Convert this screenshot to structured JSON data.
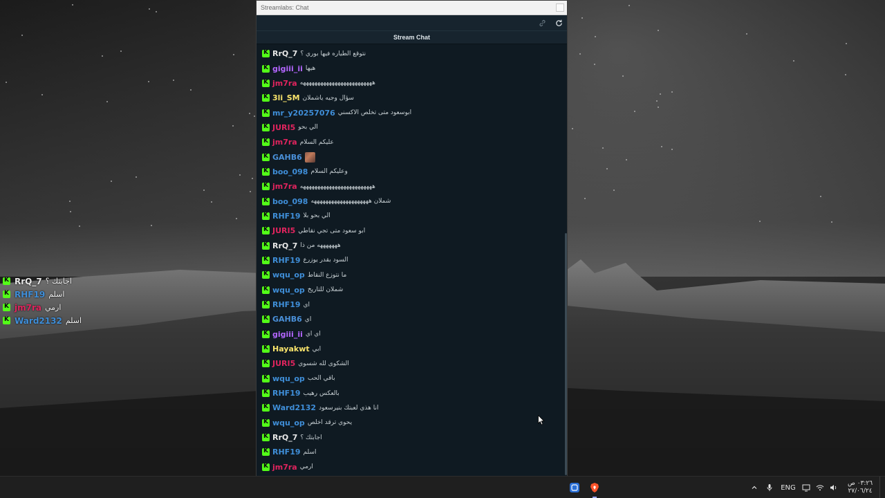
{
  "window": {
    "title": "Streamlabs: Chat",
    "header_title": "Stream Chat",
    "icons": {
      "link": "link-icon",
      "refresh": "refresh-icon",
      "close": "close-icon"
    }
  },
  "colors": {
    "platform_badge": "#53fc18",
    "chat_background": "#0f1a22",
    "header_background": "#17242e"
  },
  "messages": [
    {
      "user": "RrQ_7",
      "color": "#e6e6e6",
      "text": "نتوقع الطياره فيها بوري ؟"
    },
    {
      "user": "gigiii_ii",
      "color": "#b366ff",
      "text": "هيها"
    },
    {
      "user": "jm7ra",
      "color": "#e0245e",
      "text": "هههههههههههههههههههههههههه"
    },
    {
      "user": "3li_SM",
      "color": "#f8e36b",
      "text": "سؤال وجيه ياشملان"
    },
    {
      "user": "mr_y20257076",
      "color": "#3f8ed8",
      "text": "ابوسعود متى تخلص الاكسني"
    },
    {
      "user": "JURI5",
      "color": "#e0245e",
      "text": "الي بحو"
    },
    {
      "user": "jm7ra",
      "color": "#e0245e",
      "text": "عليكم السلام"
    },
    {
      "user": "GAHB6",
      "color": "#4a90d9",
      "text": "",
      "emote": true
    },
    {
      "user": "boo_098",
      "color": "#3f8ed8",
      "text": "وعليكم السلام"
    },
    {
      "user": "jm7ra",
      "color": "#e0245e",
      "text": "هههههههههههههههههههههههههه"
    },
    {
      "user": "boo_098",
      "color": "#3f8ed8",
      "text": "شملان ههههههههههههههههههههه"
    },
    {
      "user": "RHF19",
      "color": "#3f8ed8",
      "text": "الي بحو بلا"
    },
    {
      "user": "JURI5",
      "color": "#e0245e",
      "text": "ابو سعود متى تجي نقاطي"
    },
    {
      "user": "RrQ_7",
      "color": "#e6e6e6",
      "text": "هههههههه من ذا"
    },
    {
      "user": "RHF19",
      "color": "#3f8ed8",
      "text": "السود بقدر يوزرع"
    },
    {
      "user": "wqu_op",
      "color": "#3f8ed8",
      "text": "ما نتوزع النقاط"
    },
    {
      "user": "wqu_op",
      "color": "#3f8ed8",
      "text": "شملان للتاريخ"
    },
    {
      "user": "RHF19",
      "color": "#3f8ed8",
      "text": "اي"
    },
    {
      "user": "GAHB6",
      "color": "#4a90d9",
      "text": "اي"
    },
    {
      "user": "gigiii_ii",
      "color": "#b366ff",
      "text": "اي اي"
    },
    {
      "user": "Hayakwt",
      "color": "#f8e36b",
      "text": "ابي"
    },
    {
      "user": "JURI5",
      "color": "#e0245e",
      "text": "الشكوى لله شسوي"
    },
    {
      "user": "wqu_op",
      "color": "#3f8ed8",
      "text": "باقي الحب"
    },
    {
      "user": "RHF19",
      "color": "#3f8ed8",
      "text": "بالعكس رهيب"
    },
    {
      "user": "Ward2132",
      "color": "#3f8ed8",
      "text": "انا هذي لعبتك بنيرسعود"
    },
    {
      "user": "wqu_op",
      "color": "#3f8ed8",
      "text": "يحوي ترقد اخلص"
    },
    {
      "user": "RrQ_7",
      "color": "#e6e6e6",
      "text": "اجابتك ؟"
    },
    {
      "user": "RHF19",
      "color": "#3f8ed8",
      "text": "اسلم"
    },
    {
      "user": "jm7ra",
      "color": "#e0245e",
      "text": "ارمي"
    },
    {
      "user": "Ward2132",
      "color": "#3f8ed8",
      "text": "اسلم"
    }
  ],
  "overlay_messages": [
    {
      "user": "RrQ_7",
      "color": "#e6e6e6",
      "text": "اجابتك ؟"
    },
    {
      "user": "RHF19",
      "color": "#3f8ed8",
      "text": "اسلم"
    },
    {
      "user": "jm7ra",
      "color": "#e0245e",
      "text": "ارمي"
    },
    {
      "user": "Ward2132",
      "color": "#3f8ed8",
      "text": "اسلم"
    }
  ],
  "taskbar": {
    "language": "ENG",
    "clock_time": "٠٣:٢٦ ص",
    "clock_date": "٢٧/٠٦/٢٤",
    "apps": [
      "app-icon",
      "brave-browser-icon"
    ],
    "tray_icons": [
      "chevron-up-icon",
      "microphone-icon",
      "display-icon",
      "wifi-icon",
      "volume-icon"
    ]
  }
}
